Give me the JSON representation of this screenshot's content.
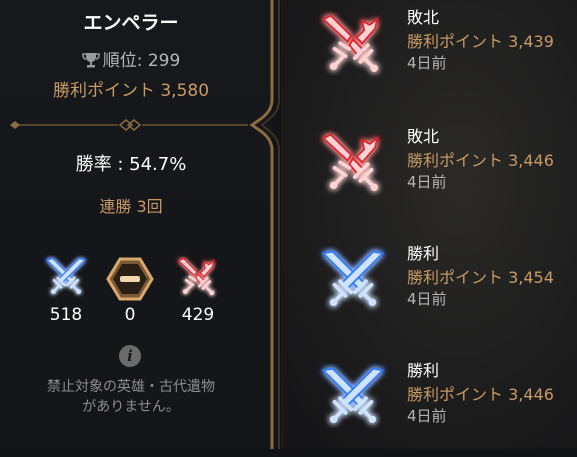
{
  "player": {
    "name": "エンペラー",
    "rank_label": "順位: 299",
    "points_label": "勝利ポイント 3,580"
  },
  "stats": {
    "win_rate": "勝率 : 54.7%",
    "streak": "連勝 3回",
    "wins": "518",
    "draws": "0",
    "losses": "429"
  },
  "notice": {
    "line1": "禁止対象の英雄・古代遺物",
    "line2": "がありません。"
  },
  "matches": [
    {
      "result": "敗北",
      "points": "勝利ポイント 3,439",
      "time": "4日前",
      "outcome": "loss"
    },
    {
      "result": "敗北",
      "points": "勝利ポイント 3,446",
      "time": "4日前",
      "outcome": "loss"
    },
    {
      "result": "勝利",
      "points": "勝利ポイント 3,454",
      "time": "4日前",
      "outcome": "win"
    },
    {
      "result": "勝利",
      "points": "勝利ポイント 3,446",
      "time": "4日前",
      "outcome": "win"
    }
  ],
  "colors": {
    "gold": "#c99a64",
    "win_blue": "#2f7dff",
    "loss_red": "#e2202a"
  }
}
